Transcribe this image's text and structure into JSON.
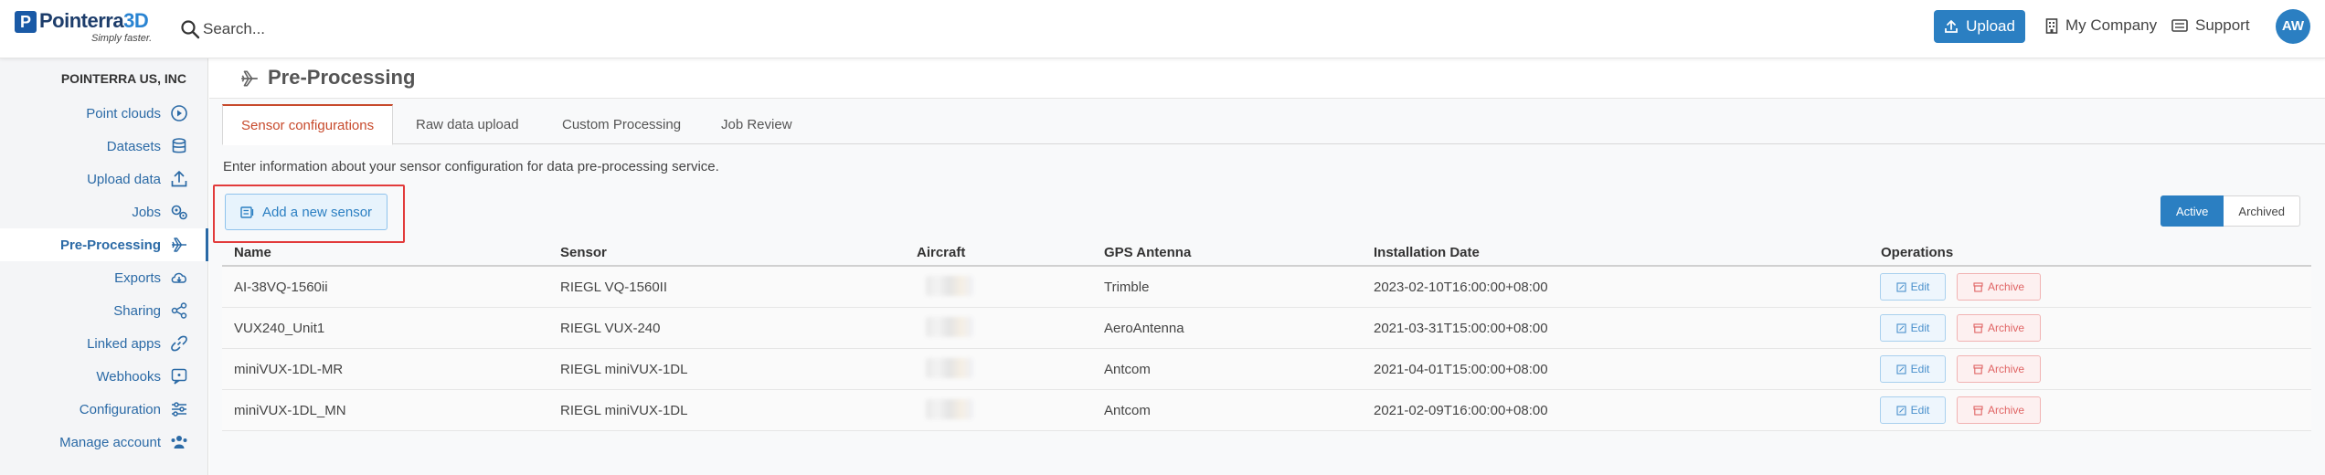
{
  "header": {
    "logo_text": "Pointerra3D",
    "logo_tagline": "Simply faster.",
    "search_placeholder": "Search...",
    "upload_label": "Upload",
    "company_label": "My Company",
    "support_label": "Support",
    "avatar_initials": "AW"
  },
  "sidebar": {
    "org_name": "POINTERRA US, INC",
    "items": [
      {
        "label": "Point clouds",
        "icon": "play-circle-icon"
      },
      {
        "label": "Datasets",
        "icon": "database-icon"
      },
      {
        "label": "Upload data",
        "icon": "upload-icon"
      },
      {
        "label": "Jobs",
        "icon": "gears-icon"
      },
      {
        "label": "Pre-Processing",
        "icon": "plane-icon",
        "active": true
      },
      {
        "label": "Exports",
        "icon": "cloud-download-icon"
      },
      {
        "label": "Sharing",
        "icon": "share-icon"
      },
      {
        "label": "Linked apps",
        "icon": "link-icon"
      },
      {
        "label": "Webhooks",
        "icon": "webhook-icon"
      },
      {
        "label": "Configuration",
        "icon": "sliders-icon"
      },
      {
        "label": "Manage account",
        "icon": "users-icon"
      }
    ]
  },
  "page": {
    "title": "Pre-Processing",
    "tabs": [
      {
        "label": "Sensor configurations",
        "active": true
      },
      {
        "label": "Raw data upload"
      },
      {
        "label": "Custom Processing"
      },
      {
        "label": "Job Review"
      }
    ],
    "intro": "Enter information about your sensor configuration for data pre-processing service.",
    "add_button": "Add a new sensor",
    "filter": {
      "active": "Active",
      "archived": "Archived"
    }
  },
  "table": {
    "headers": {
      "name": "Name",
      "sensor": "Sensor",
      "aircraft": "Aircraft",
      "gps": "GPS Antenna",
      "date": "Installation Date",
      "ops": "Operations"
    },
    "rows": [
      {
        "name": "AI-38VQ-1560ii",
        "sensor": "RIEGL VQ-1560II",
        "gps": "Trimble",
        "date": "2023-02-10T16:00:00+08:00"
      },
      {
        "name": "VUX240_Unit1",
        "sensor": "RIEGL VUX-240",
        "gps": "AeroAntenna",
        "date": "2021-03-31T15:00:00+08:00"
      },
      {
        "name": "miniVUX-1DL-MR",
        "sensor": "RIEGL miniVUX-1DL",
        "gps": "Antcom",
        "date": "2021-04-01T15:00:00+08:00"
      },
      {
        "name": "miniVUX-1DL_MN",
        "sensor": "RIEGL miniVUX-1DL",
        "gps": "Antcom",
        "date": "2021-02-09T16:00:00+08:00"
      }
    ],
    "edit_label": "Edit",
    "archive_label": "Archive"
  },
  "colors": {
    "brand": "#2b7fc2",
    "active_tab": "#c74a2c",
    "highlight_frame": "#e23b3b"
  }
}
